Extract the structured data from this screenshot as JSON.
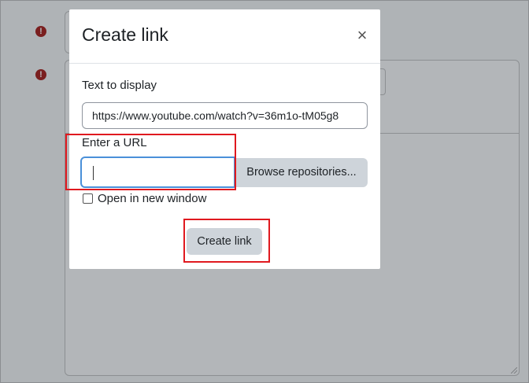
{
  "background": {
    "error_icon_glyph": "!"
  },
  "modal": {
    "title": "Create link",
    "close_glyph": "×",
    "text_to_display": {
      "label": "Text to display",
      "value": "https://www.youtube.com/watch?v=36m1o-tM05g8"
    },
    "url": {
      "label": "Enter a URL",
      "value": ""
    },
    "browse_button_label": "Browse repositories...",
    "open_new_window": {
      "label": "Open in new window",
      "checked": false
    },
    "create_button_label": "Create link"
  },
  "colors": {
    "highlight": "#e0191f",
    "focus_border": "#4a90d9",
    "button_bg": "#ced4da",
    "overlay": "#afb3b6",
    "error_icon": "#7a1f1f"
  },
  "icons": {
    "close": "close-icon",
    "error": "exclamation-circle-icon"
  }
}
